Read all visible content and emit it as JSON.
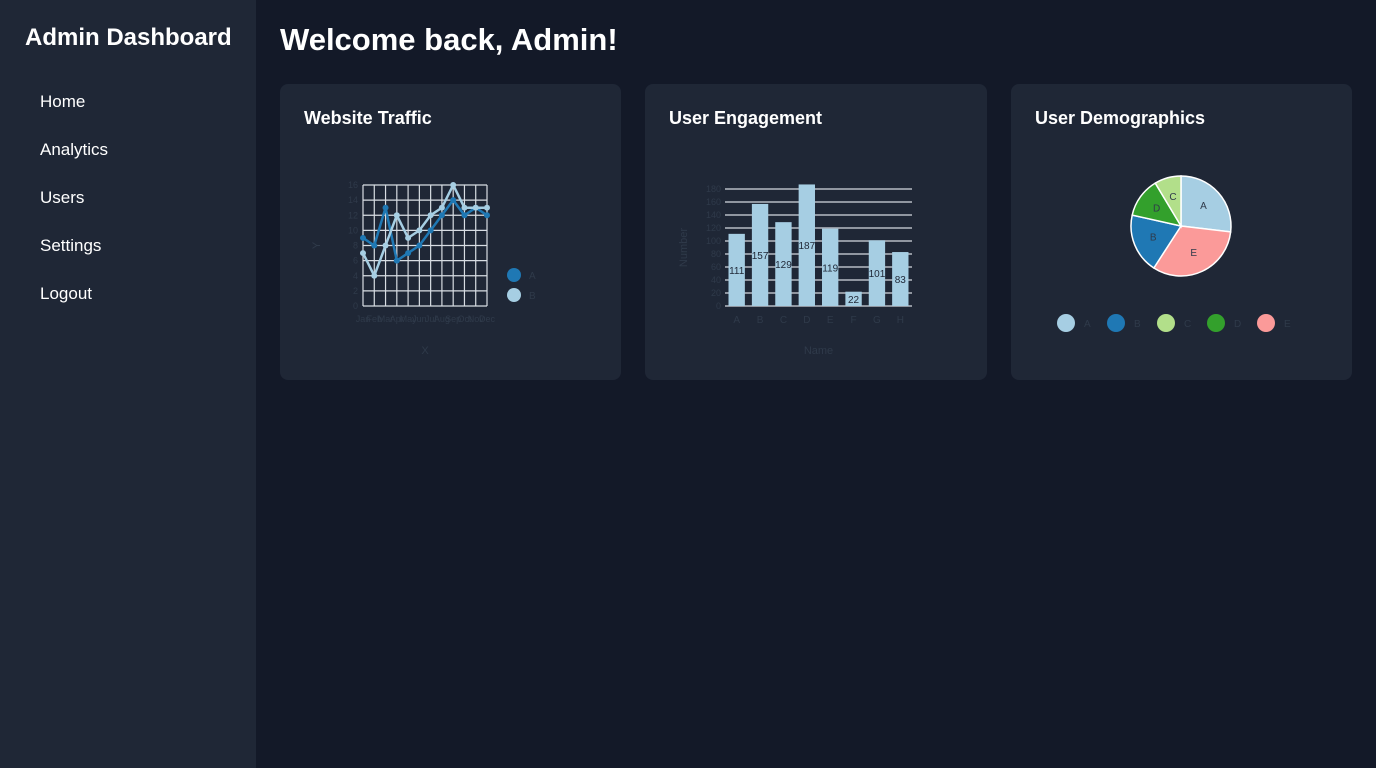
{
  "sidebar": {
    "title": "Admin Dashboard",
    "items": [
      {
        "label": "Home"
      },
      {
        "label": "Analytics"
      },
      {
        "label": "Users"
      },
      {
        "label": "Settings"
      },
      {
        "label": "Logout"
      }
    ]
  },
  "main": {
    "title": "Welcome back, Admin!"
  },
  "cards": {
    "traffic": {
      "title": "Website Traffic"
    },
    "engagement": {
      "title": "User Engagement"
    },
    "demographics": {
      "title": "User Demographics"
    }
  },
  "colors": {
    "background": "#131928",
    "panel": "#1f2736",
    "text": "#ffffff",
    "axis_text": "#2f3a4a",
    "series_dark_blue": "#1f78b4",
    "series_light_blue": "#a6cee3",
    "series_light_green": "#b2df8a",
    "series_green": "#33a02c",
    "series_pink": "#fb9a99"
  },
  "chart_data": [
    {
      "type": "line",
      "x": [
        "Jan",
        "Feb",
        "Mar",
        "Apr",
        "May",
        "Jun",
        "Jul",
        "Aug",
        "Sep",
        "Oct",
        "Nov",
        "Dec"
      ],
      "xlabel": "X",
      "ylabel": "Y",
      "ylim": [
        0,
        16
      ],
      "y_ticks": [
        0,
        2,
        4,
        6,
        8,
        10,
        12,
        14,
        16
      ],
      "grid": true,
      "legend": "right",
      "series": [
        {
          "name": "A",
          "color": "#1f78b4",
          "values": [
            9,
            8,
            13,
            6,
            7,
            8,
            10,
            12,
            14,
            12,
            13,
            12
          ]
        },
        {
          "name": "B",
          "color": "#a6cee3",
          "values": [
            7,
            4,
            8,
            12,
            9,
            10,
            12,
            13,
            16,
            13,
            13,
            13
          ]
        }
      ]
    },
    {
      "type": "bar",
      "categories": [
        "A",
        "B",
        "C",
        "D",
        "E",
        "F",
        "G",
        "H"
      ],
      "values": [
        111,
        157,
        129,
        187,
        119,
        22,
        101,
        83
      ],
      "xlabel": "Name",
      "ylabel": "Number",
      "ylim": [
        0,
        180
      ],
      "y_ticks": [
        0,
        20,
        40,
        60,
        80,
        100,
        120,
        140,
        160,
        180
      ],
      "grid": true,
      "color": "#a6cee3"
    },
    {
      "type": "pie",
      "labels": [
        "A",
        "B",
        "C",
        "D",
        "E"
      ],
      "values": [
        25,
        18,
        8,
        12,
        30
      ],
      "colors": [
        "#a6cee3",
        "#1f78b4",
        "#b2df8a",
        "#33a02c",
        "#fb9a99"
      ],
      "legend": "bottom"
    }
  ]
}
